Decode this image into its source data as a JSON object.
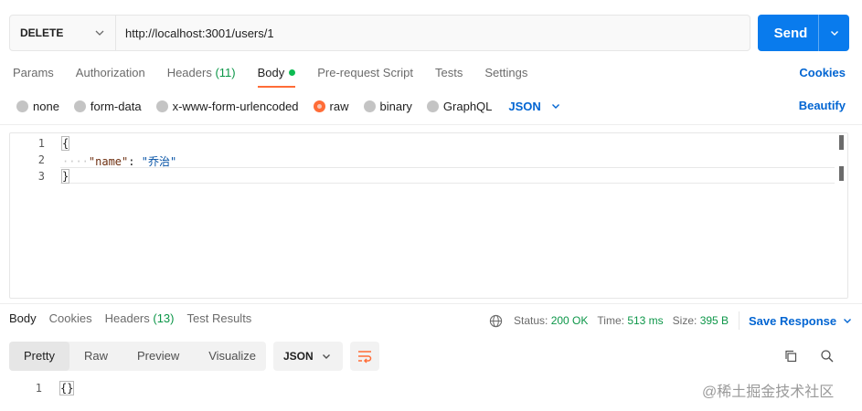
{
  "request": {
    "method": "DELETE",
    "url": "http://localhost:3001/users/1",
    "send_label": "Send"
  },
  "tabs": [
    {
      "label": "Params"
    },
    {
      "label": "Authorization"
    },
    {
      "label": "Headers",
      "count": "(11)"
    },
    {
      "label": "Body",
      "active": true
    },
    {
      "label": "Pre-request Script"
    },
    {
      "label": "Tests"
    },
    {
      "label": "Settings"
    }
  ],
  "cookies_label": "Cookies",
  "body_types": {
    "none": "none",
    "form_data": "form-data",
    "urlencoded": "x-www-form-urlencoded",
    "raw": "raw",
    "binary": "binary",
    "graphql": "GraphQL",
    "language": "JSON",
    "selected": "raw"
  },
  "beautify_label": "Beautify",
  "editor": {
    "line_numbers": [
      "1",
      "2",
      "3"
    ],
    "open_brace": "{",
    "indent": "····",
    "key": "\"name\"",
    "colon": ": ",
    "value": "\"乔治\"",
    "close_brace": "}"
  },
  "response": {
    "tabs": {
      "body": "Body",
      "cookies": "Cookies",
      "headers": "Headers",
      "headers_count": "(13)",
      "test_results": "Test Results"
    },
    "status_label": "Status:",
    "status_value": "200 OK",
    "time_label": "Time:",
    "time_value": "513 ms",
    "size_label": "Size:",
    "size_value": "395 B",
    "save_label": "Save Response",
    "views": {
      "pretty": "Pretty",
      "raw": "Raw",
      "preview": "Preview",
      "visualize": "Visualize"
    },
    "format": "JSON",
    "line_number": "1",
    "body_text": "{}"
  },
  "watermark": "@稀土掘金技术社区",
  "colors": {
    "accent": "#ff6c37",
    "primary": "#097bed",
    "link": "#0265d2",
    "success": "#0c9648"
  }
}
